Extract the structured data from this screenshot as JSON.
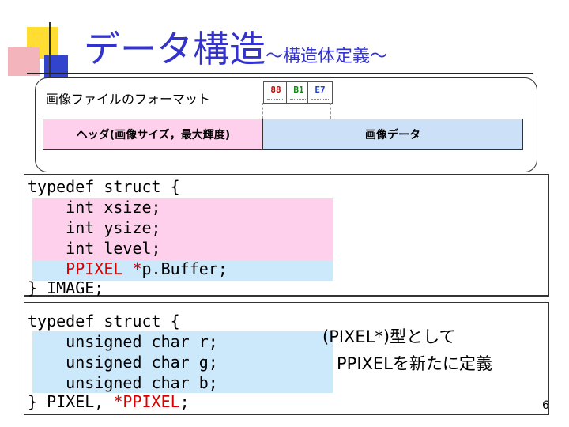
{
  "slide": {
    "title_main": "データ構造",
    "title_sub": "～構造体定義～",
    "page_number": "6"
  },
  "format_panel": {
    "label": "画像ファイルのフォーマット",
    "hex_bytes": [
      "88",
      "B1",
      "E7"
    ],
    "header_cell": "ヘッダ(画像サイズ，最大輝度)",
    "image_cell": "画像データ"
  },
  "code_image": {
    "line1": "typedef struct {",
    "line2": "    int xsize;",
    "line3": "    int ysize;",
    "line4": "    int level;",
    "line5_type": "    PPIXEL *",
    "line5_rest": "p.Buffer;",
    "line6": "} IMAGE;"
  },
  "code_pixel": {
    "line1": "typedef struct {",
    "line2": "    unsigned char r;",
    "line3": "    unsigned char g;",
    "line4": "    unsigned char b;",
    "line5_prefix": "} PIXEL, ",
    "line5_red": "*PPIXEL",
    "line5_suffix": ";"
  },
  "note": {
    "line1": "(PIXEL*)型として",
    "line2": "PPIXELを新たに定義"
  },
  "colors": {
    "title": "#3333cc",
    "header_fill": "#ffd0ec",
    "image_fill": "#cce0f8",
    "highlight_pink": "#ffd0ec",
    "highlight_blue": "#cce8fb",
    "keyword_red": "#dd0000"
  }
}
